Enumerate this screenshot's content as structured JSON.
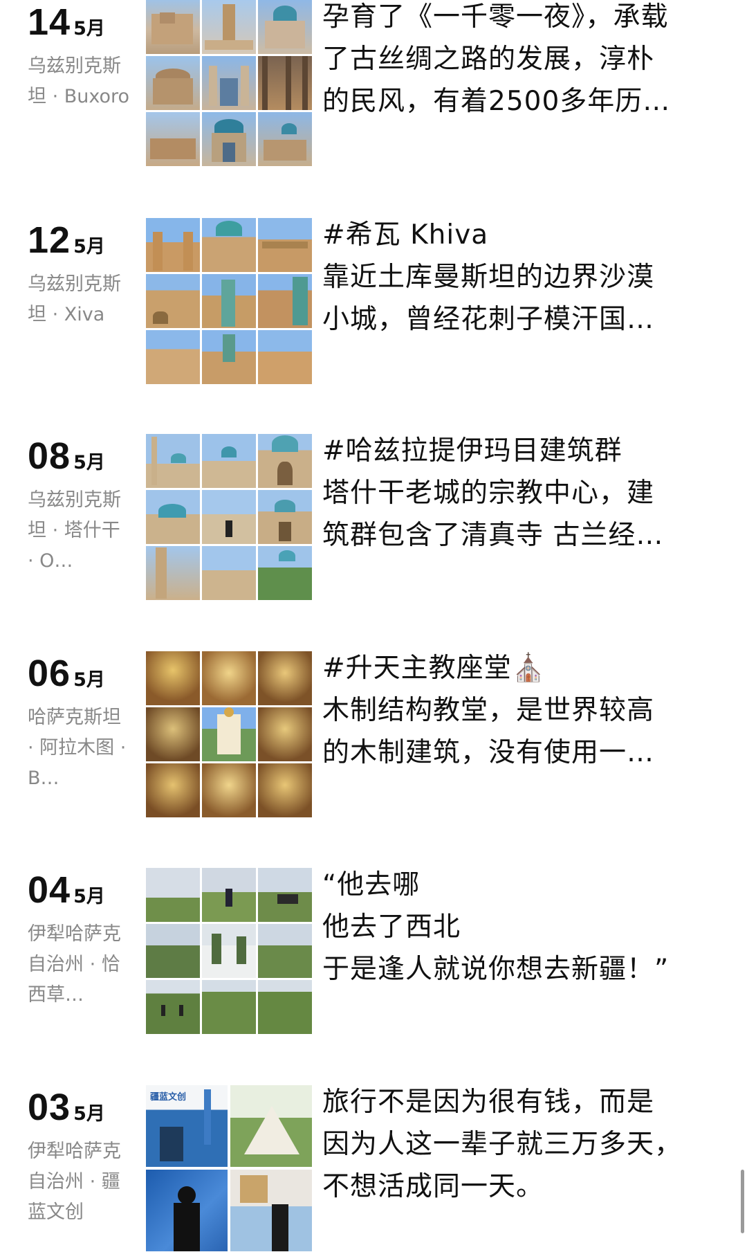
{
  "posts": [
    {
      "day": "14",
      "month": "5月",
      "location": "乌兹别克斯坦 · Buxoro",
      "lines": [
        "孕育了《一千零一夜》，承载",
        "了古丝绸之路的发展，淳朴",
        "的民风，有着2500多年历…"
      ],
      "photo_theme": "bukhara-architecture"
    },
    {
      "day": "12",
      "month": "5月",
      "location": "乌兹别克斯坦 · Xiva",
      "lines": [
        "#希瓦 Khiva",
        "靠近土库曼斯坦的边界沙漠",
        "小城，曾经花刺子模汗国…"
      ],
      "photo_theme": "khiva-desert-city"
    },
    {
      "day": "08",
      "month": "5月",
      "location": "乌兹别克斯坦 · 塔什干 · O…",
      "lines": [
        "#哈兹拉提伊玛目建筑群",
        "塔什干老城的宗教中心，建",
        "筑群包含了清真寺 古兰经…"
      ],
      "photo_theme": "hazrati-imam-complex"
    },
    {
      "day": "06",
      "month": "5月",
      "location": "哈萨克斯坦 · 阿拉木图 · B…",
      "lines": [
        "#升天主教座堂⛪",
        "木制结构教堂，是世界较高",
        "的木制建筑，没有使用一…"
      ],
      "photo_theme": "ascension-cathedral"
    },
    {
      "day": "04",
      "month": "5月",
      "location": "伊犁哈萨克自治州 · 恰西草…",
      "lines": [
        "“他去哪",
        "他去了西北",
        "于是逢人就说你想去新疆！”"
      ],
      "photo_theme": "qiaxi-grassland"
    },
    {
      "day": "03",
      "month": "5月",
      "location": "伊犁哈萨克自治州 · 疆蓝文创",
      "lines": [
        "旅行不是因为很有钱，而是",
        "因为人这一辈子就三万多天，",
        "不想活成同一天。"
      ],
      "photo_theme": "jianglan-wenchuang"
    }
  ],
  "colors": {
    "date": "#111111",
    "location": "#888888",
    "body_text": "#111111",
    "scrollbar": "#9a9a9a"
  },
  "icons": {
    "post6_sign_text": "疆蓝文创"
  }
}
